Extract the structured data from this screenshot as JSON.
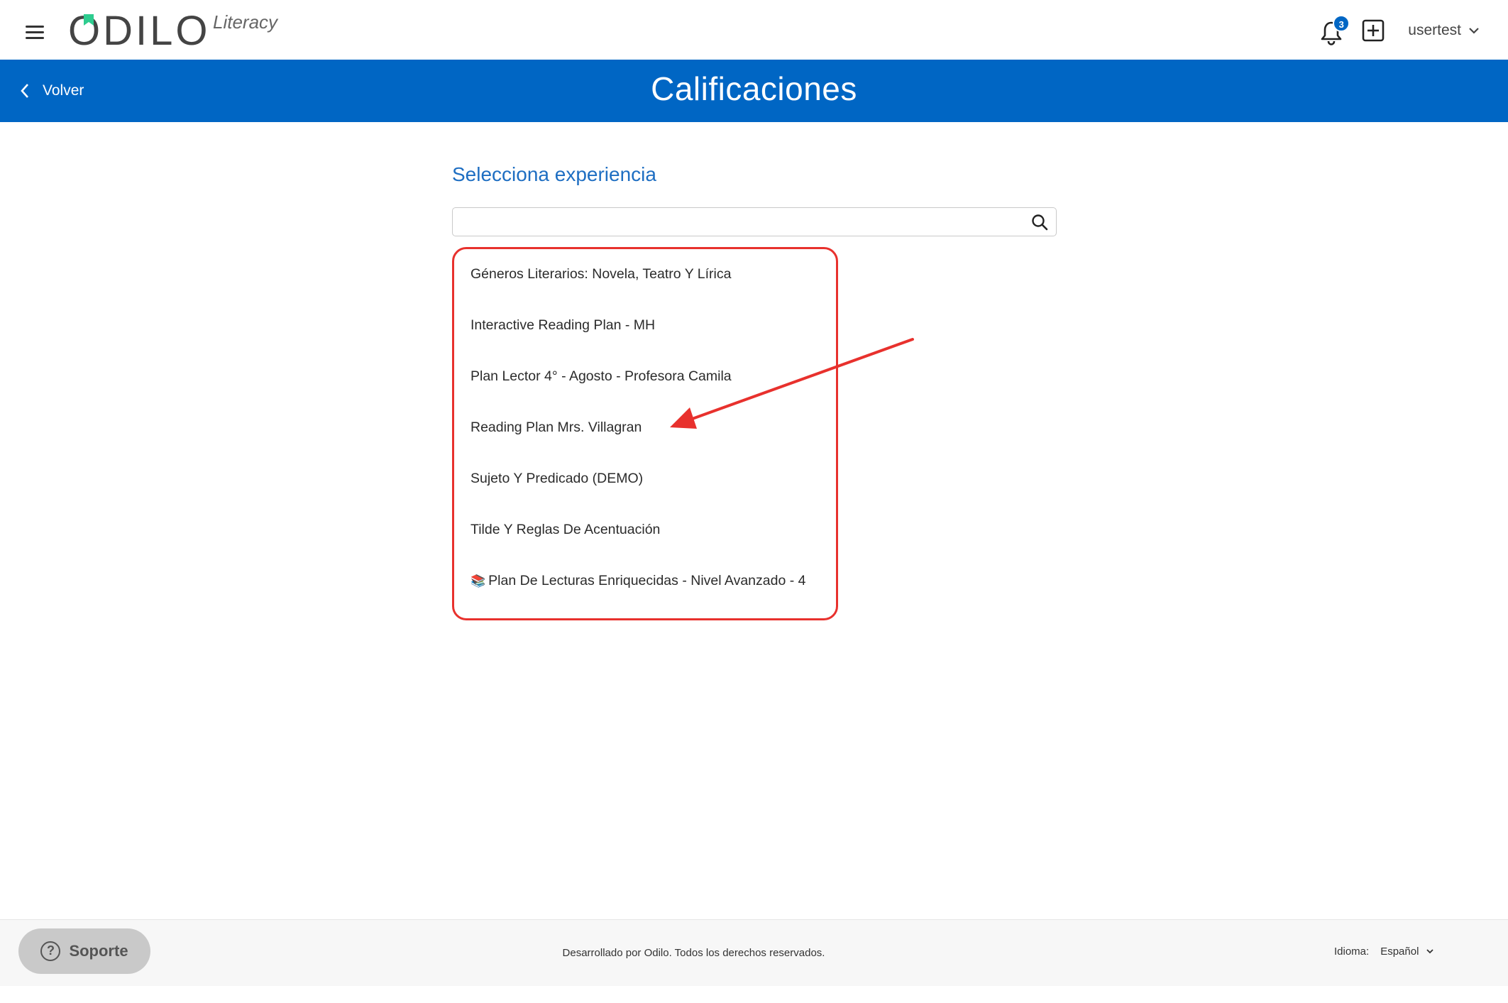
{
  "header": {
    "logo_text": "ODILO",
    "logo_sub": "Literacy",
    "notification_count": "3",
    "username": "usertest"
  },
  "titlebar": {
    "back_label": "Volver",
    "title": "Calificaciones"
  },
  "main": {
    "heading": "Selecciona experiencia",
    "search_placeholder": "",
    "experiences": [
      "Géneros Literarios: Novela, Teatro Y Lírica",
      "Interactive Reading Plan - MH",
      "Plan Lector 4° - Agosto - Profesora Camila",
      "Reading Plan Mrs. Villagran",
      "Sujeto Y Predicado (DEMO)",
      "Tilde Y Reglas De Acentuación",
      "Plan De Lecturas Enriquecidas - Nivel Avanzado - 4"
    ],
    "last_item_icon": "books-emoji-icon"
  },
  "footer": {
    "support_label": "Soporte",
    "copyright": "Desarrollado por Odilo. Todos los derechos reservados.",
    "language_label": "Idioma:",
    "language_value": "Español"
  },
  "colors": {
    "brand_blue": "#0066c4",
    "heading_blue": "#1e6ec2",
    "annotation_red": "#e8312d",
    "logo_accent": "#2ecc8f"
  }
}
